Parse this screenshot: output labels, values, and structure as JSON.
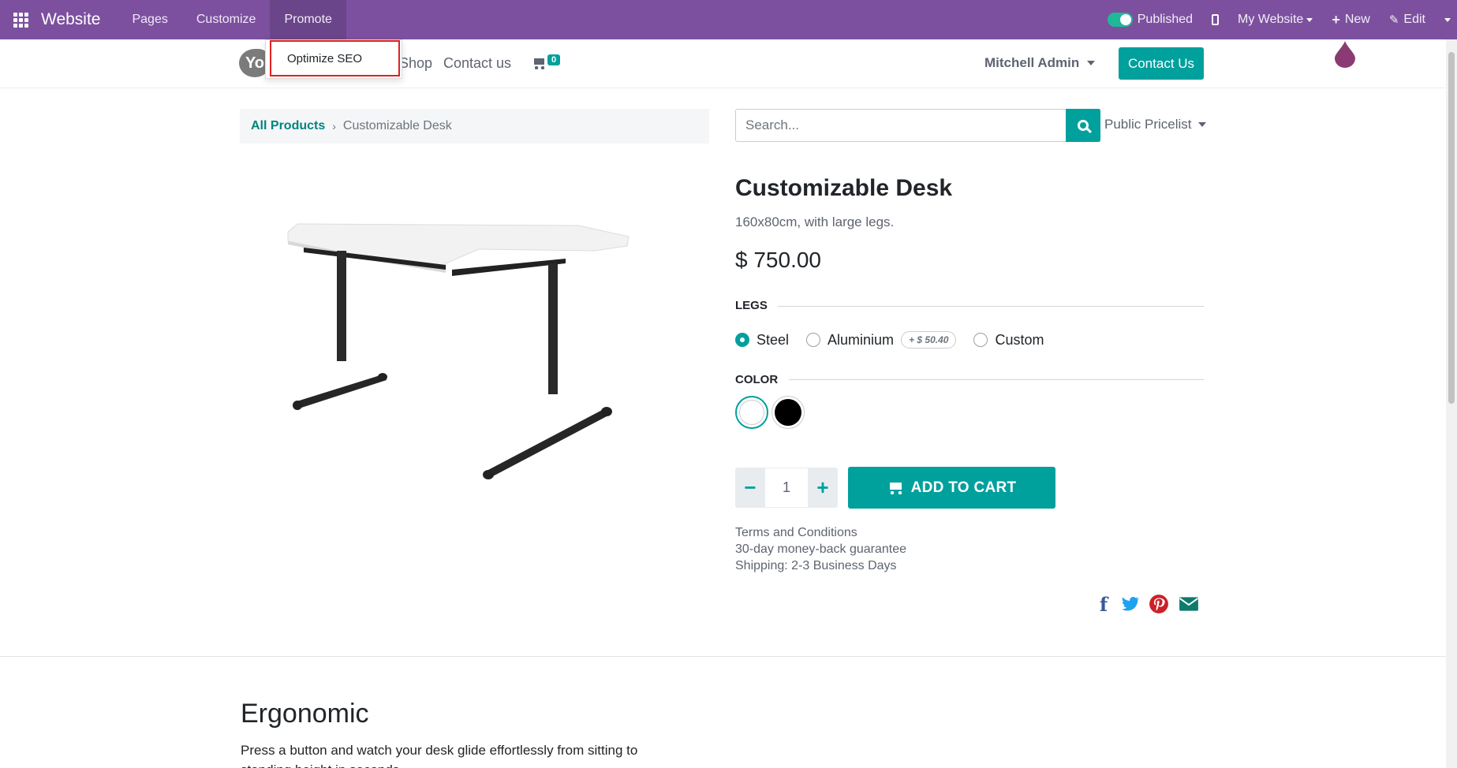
{
  "topbar": {
    "brand": "Website",
    "menus": [
      "Pages",
      "Customize",
      "Promote"
    ],
    "published_label": "Published",
    "site_selector": "My Website",
    "new_label": "New",
    "edit_label": "Edit",
    "bg_color": "#7c509f"
  },
  "dropdown": {
    "item": "Optimize SEO"
  },
  "header": {
    "nav": [
      "Shop",
      "Contact us"
    ],
    "cart_count": "0",
    "user": "Mitchell Admin",
    "contact_button": "Contact Us",
    "logo_text": "Yo"
  },
  "breadcrumb": {
    "link": "All Products",
    "current": "Customizable Desk"
  },
  "search": {
    "placeholder": "Search...",
    "pricelist": "Public Pricelist"
  },
  "product": {
    "title": "Customizable Desk",
    "subtitle": "160x80cm, with large legs.",
    "price": "$ 750.00",
    "legs_label": "LEGS",
    "legs_options": [
      "Steel",
      "Aluminium",
      "Custom"
    ],
    "legs_selected": "Steel",
    "aluminium_extra": "+ $ 50.40",
    "color_label": "COLOR",
    "colors": [
      "#ffffff",
      "#000000"
    ],
    "quantity": "1",
    "add_to_cart": "ADD TO CART",
    "info": [
      "Terms and Conditions",
      "30-day money-back guarantee",
      "Shipping: 2-3 Business Days"
    ]
  },
  "share_icons": [
    "facebook-icon",
    "twitter-icon",
    "pinterest-icon",
    "envelope-icon"
  ],
  "section": {
    "heading": "Ergonomic",
    "text": "Press a button and watch your desk glide effortlessly from sitting to standing height in seconds."
  },
  "accent_color": "#00a09d"
}
